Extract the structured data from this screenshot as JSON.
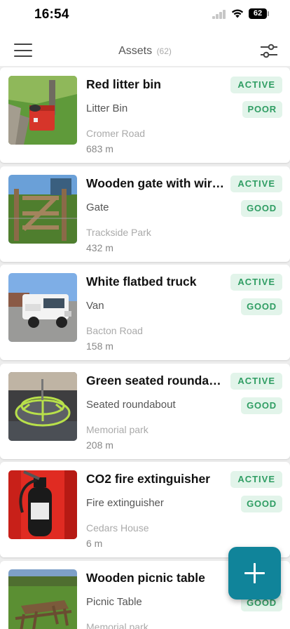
{
  "status_bar": {
    "time": "16:54",
    "battery": "62"
  },
  "header": {
    "title": "Assets",
    "count": "(62)"
  },
  "assets": [
    {
      "title": "Red litter bin",
      "type": "Litter Bin",
      "location": "Cromer Road",
      "distance": "683 m",
      "status": "ACTIVE",
      "condition": "POOR"
    },
    {
      "title": "Wooden gate with wire fence",
      "type": "Gate",
      "location": "Trackside Park",
      "distance": "432 m",
      "status": "ACTIVE",
      "condition": "GOOD"
    },
    {
      "title": "White flatbed truck",
      "type": "Van",
      "location": "Bacton Road",
      "distance": "158 m",
      "status": "ACTIVE",
      "condition": "GOOD"
    },
    {
      "title": "Green seated roundabout",
      "type": "Seated roundabout",
      "location": "Memorial park",
      "distance": "208 m",
      "status": "ACTIVE",
      "condition": "GOOD"
    },
    {
      "title": "CO2 fire extinguisher",
      "type": "Fire extinguisher",
      "location": "Cedars House",
      "distance": "6 m",
      "status": "ACTIVE",
      "condition": "GOOD"
    },
    {
      "title": "Wooden picnic table",
      "type": "Picnic Table",
      "location": "Memorial park",
      "distance": "",
      "status": "",
      "condition": "GOOD"
    }
  ],
  "icons": {
    "menu": "hamburger-menu-icon",
    "filter": "sliders-filter-icon",
    "add": "plus-icon"
  },
  "colors": {
    "accent": "#10849a",
    "badge_bg": "#e2f4ea",
    "badge_text": "#2f9d63"
  }
}
